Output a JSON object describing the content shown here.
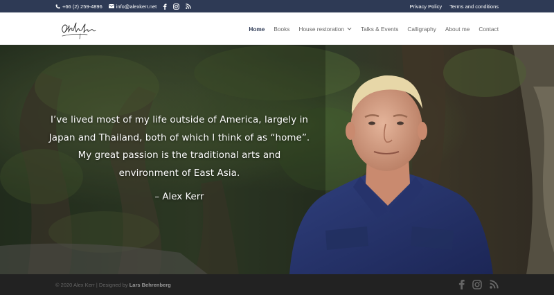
{
  "topbar": {
    "phone": "+66 (2) 259-4896",
    "email": "info@alexkerr.net",
    "social_icons": [
      "facebook-icon",
      "instagram-icon",
      "rss-icon"
    ],
    "links": [
      "Privacy Policy",
      "Terms and conditions"
    ]
  },
  "header": {
    "logo_alt": "Alex Kerr signature",
    "nav": [
      {
        "label": "Home",
        "active": true
      },
      {
        "label": "Books"
      },
      {
        "label": "House restoration",
        "has_dropdown": true
      },
      {
        "label": "Talks & Events"
      },
      {
        "label": "Calligraphy"
      },
      {
        "label": "About me"
      },
      {
        "label": "Contact"
      }
    ]
  },
  "hero": {
    "quote": "I’ve lived most of my life outside of America, largely in Japan and Thailand, both of which I think of as “home”.  My great passion is the traditional arts and environment of East Asia.",
    "author": "– Alex Kerr"
  },
  "footer": {
    "credit_prefix": "© 2020 Alex Kerr | Designed by ",
    "credit_name": "Lars Behrenberg",
    "social_icons": [
      "facebook-icon",
      "instagram-icon",
      "rss-icon"
    ]
  },
  "colors": {
    "topbar_bg": "#2e3a55",
    "nav_active": "#2e3a55",
    "footer_bg": "#222222"
  }
}
